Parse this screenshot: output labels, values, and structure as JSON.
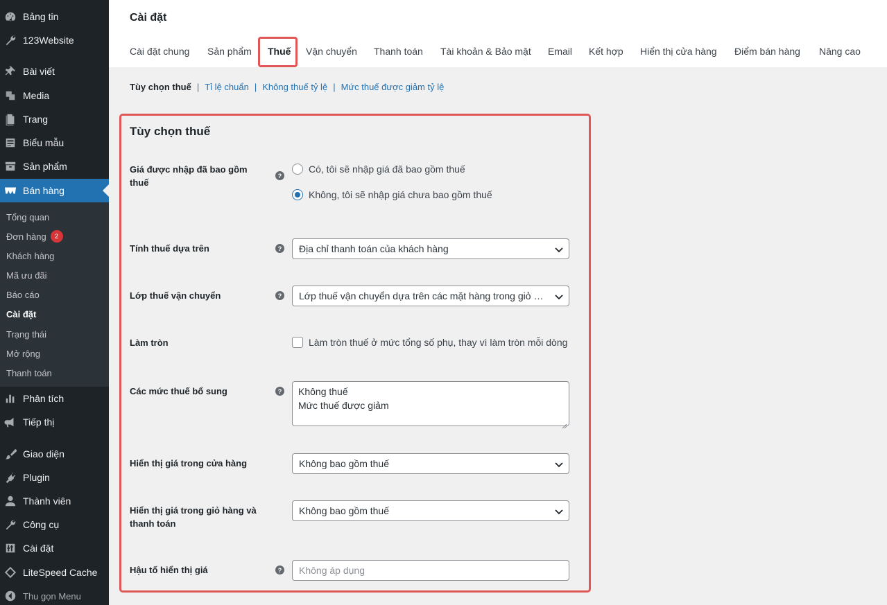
{
  "sidebar": {
    "top_items": [
      {
        "label": "Bảng tin",
        "icon": "dashboard-icon"
      },
      {
        "label": "123Website",
        "icon": "wrench-icon"
      },
      {
        "label": "Bài viết",
        "icon": "pin-icon"
      },
      {
        "label": "Media",
        "icon": "media-icon"
      },
      {
        "label": "Trang",
        "icon": "page-icon"
      },
      {
        "label": "Biểu mẫu",
        "icon": "form-icon"
      },
      {
        "label": "Sản phẩm",
        "icon": "archive-icon"
      },
      {
        "label": "Bán hàng",
        "icon": "woo-icon"
      }
    ],
    "submenu": [
      {
        "label": "Tổng quan"
      },
      {
        "label": "Đơn hàng",
        "badge": "2"
      },
      {
        "label": "Khách hàng"
      },
      {
        "label": "Mã ưu đãi"
      },
      {
        "label": "Báo cáo"
      },
      {
        "label": "Cài đặt"
      },
      {
        "label": "Trạng thái"
      },
      {
        "label": "Mở rộng"
      },
      {
        "label": "Thanh toán"
      }
    ],
    "bottom_items": [
      {
        "label": "Phân tích",
        "icon": "chart-icon"
      },
      {
        "label": "Tiếp thị",
        "icon": "megaphone-icon"
      },
      {
        "label": "Giao diện",
        "icon": "brush-icon"
      },
      {
        "label": "Plugin",
        "icon": "plugin-icon"
      },
      {
        "label": "Thành viên",
        "icon": "user-icon"
      },
      {
        "label": "Công cụ",
        "icon": "tools-icon"
      },
      {
        "label": "Cài đặt",
        "icon": "settings-icon"
      },
      {
        "label": "LiteSpeed Cache",
        "icon": "litespeed-icon"
      },
      {
        "label": "Thu gọn Menu",
        "icon": "collapse-icon"
      }
    ]
  },
  "header": {
    "title": "Cài đặt",
    "tabs": [
      {
        "label": "Cài đặt chung"
      },
      {
        "label": "Sản phẩm"
      },
      {
        "label": "Thuế"
      },
      {
        "label": "Vận chuyển"
      },
      {
        "label": "Thanh toán"
      },
      {
        "label": "Tài khoản & Bảo mật"
      },
      {
        "label": "Email"
      },
      {
        "label": "Kết hợp"
      },
      {
        "label": "Hiển thị cửa hàng"
      },
      {
        "label": "Điểm bán hàng"
      },
      {
        "label": "Nâng cao"
      }
    ]
  },
  "subsections": {
    "current": "Tùy chọn thuế",
    "links": [
      "Tỉ lệ chuẩn",
      "Không thuế tỷ lệ",
      "Mức thuế được giảm tỷ lệ"
    ],
    "separator": "|"
  },
  "form": {
    "section_title": "Tùy chọn thuế",
    "help_glyph": "?",
    "prices_entered": {
      "label": "Giá được nhập đã bao gồm thuế",
      "options": [
        {
          "label": "Có, tôi sẽ nhập giá đã bao gồm thuế"
        },
        {
          "label": "Không, tôi sẽ nhập giá chưa bao gồm thuế"
        }
      ]
    },
    "calc_based_on": {
      "label": "Tính thuế dựa trên",
      "value": "Địa chỉ thanh toán của khách hàng"
    },
    "shipping_tax_class": {
      "label": "Lớp thuế vận chuyển",
      "value": "Lớp thuế vận chuyển dựa trên các mặt hàng trong giỏ hàng"
    },
    "rounding": {
      "label": "Làm tròn",
      "checkbox_label": "Làm tròn thuế ở mức tổng số phụ, thay vì làm tròn mỗi dòng"
    },
    "additional_rates": {
      "label": "Các mức thuế bổ sung",
      "lines": [
        "Không thuế",
        "Mức thuế được giảm"
      ]
    },
    "display_shop": {
      "label": "Hiển thị giá trong cửa hàng",
      "value": "Không bao gồm thuế"
    },
    "display_cart": {
      "label": "Hiển thị giá trong giỏ hàng và thanh toán",
      "value": "Không bao gồm thuế"
    },
    "price_suffix": {
      "label": "Hậu tố hiển thị giá",
      "placeholder": "Không áp dụng"
    }
  }
}
